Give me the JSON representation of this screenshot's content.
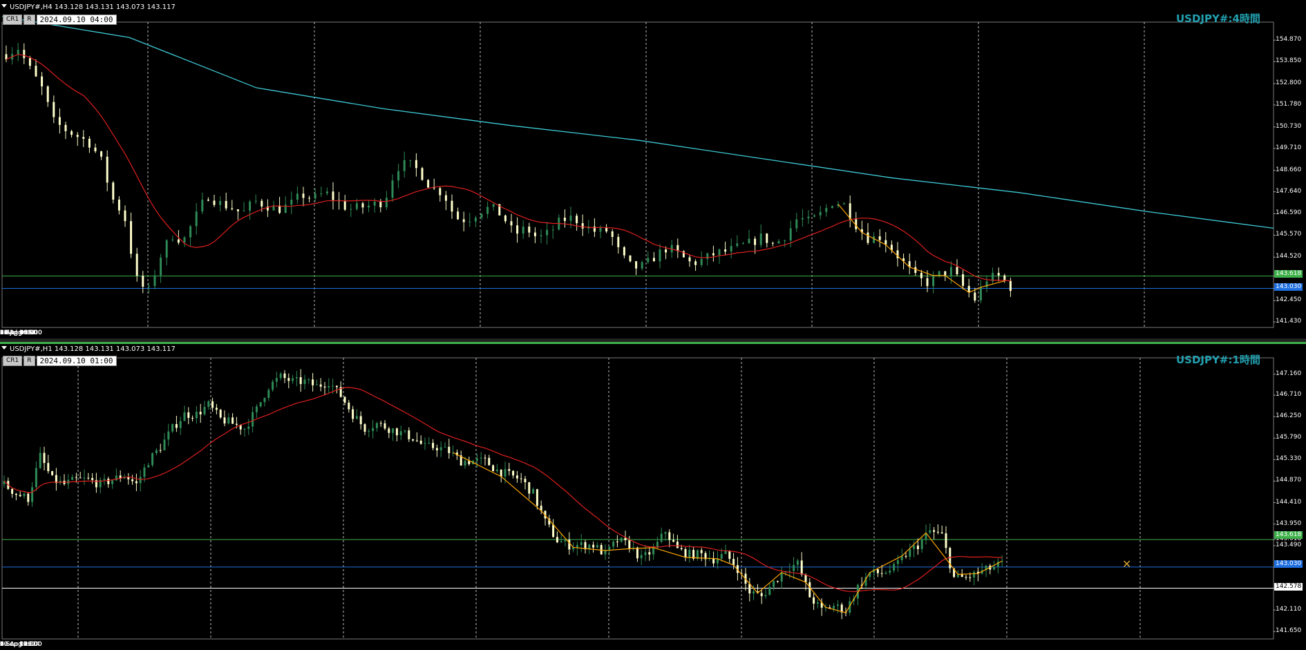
{
  "colors": {
    "bull": "#2e8b57",
    "bear": "#ffffcc",
    "ma_fast": "#e0201e",
    "ma_slow": "#3ecad6",
    "zigzag": "#ffa500",
    "title": "#22a0b0",
    "hline_green": "#3fb24b",
    "hline_blue": "#1f6fe0",
    "hline_white": "#ffffff"
  },
  "top": {
    "header": "USDJPY#,H4  143.128 143.131 143.073 143.117",
    "btn1": "CR1",
    "btn2": "R",
    "datetime": "2024.09.10 04:00",
    "window_title": "USDJPY#:4時間",
    "y_ticks": [
      "154.870",
      "153.850",
      "152.800",
      "151.780",
      "150.730",
      "149.710",
      "148.660",
      "147.640",
      "146.590",
      "145.570",
      "144.520",
      "143.618",
      "143.030",
      "142.450",
      "141.430"
    ],
    "x_ticks": [
      "29 Jul 2024",
      "31 Jul 00:00",
      "1 Aug 08:00",
      "2 Aug 16:00",
      "6 Aug 00:00",
      "7 Aug 08:00",
      "8 Aug 16:00",
      "12 Aug 00:00",
      "13 Aug 08:00",
      "14 Aug 16:00",
      "16 Aug 00:00",
      "19 Aug 08:00",
      "20 Aug 16:00",
      "22 Aug 00:00",
      "23 Aug 08:00",
      "26 Aug 16:00",
      "28 Aug 00:00",
      "29 Aug 08:00",
      "30 Aug 16:00",
      "3 Sep 00:00",
      "4 Sep 08:00",
      "5 Sep 16:00",
      "9 Sep 00:00"
    ],
    "price_tags": {
      "green": "143.618",
      "blue": "143.030"
    }
  },
  "bottom": {
    "header": "USDJPY#,H1  143.128 143.131 143.073 143.117",
    "btn1": "CR1",
    "btn2": "R",
    "datetime": "2024.09.10 01:00",
    "window_title": "USDJPY#:1時間",
    "y_ticks": [
      "147.160",
      "146.710",
      "146.250",
      "145.790",
      "145.330",
      "144.870",
      "144.410",
      "143.950",
      "143.618",
      "143.490",
      "143.030",
      "142.578",
      "142.110",
      "141.650"
    ],
    "x_ticks": [
      "29 Aug 2024",
      "29 Aug 18:00",
      "30 Aug 02:00",
      "30 Aug 10:00",
      "30 Aug 18:00",
      "2 Sep 02:00",
      "2 Sep 10:00",
      "2 Sep 18:00",
      "3 Sep 02:00",
      "3 Sep 10:00",
      "3 Sep 18:00",
      "4 Sep 02:00",
      "4 Sep 10:00",
      "4 Sep 18:00",
      "5 Sep 02:00",
      "5 Sep 10:00",
      "5 Sep 18:00",
      "6 Sep 02:00",
      "6 Sep 10:00",
      "6 Sep 18:00",
      "9 Sep 02:00",
      "9 Sep 10:00",
      "9 Sep 18:00"
    ],
    "price_tags": {
      "green": "143.618",
      "blue": "143.030",
      "white": "142.578"
    }
  },
  "chart_data": [
    {
      "type": "candlestick",
      "timeframe": "H4",
      "ylim": [
        141.3,
        155.6
      ],
      "close_path": [
        154.2,
        154.5,
        153.5,
        152.6,
        151.0,
        150.6,
        150.3,
        150.0,
        149.2,
        147.3,
        146.5,
        143.5,
        142.8,
        144.5,
        145.6,
        145.3,
        146.4,
        147.5,
        147.1,
        146.9,
        146.6,
        147.2,
        147.0,
        146.8,
        147.0,
        147.5,
        147.3,
        147.6,
        147.2,
        146.8,
        146.9,
        147.0,
        147.2,
        148.8,
        149.0,
        148.6,
        147.8,
        147.6,
        146.4,
        146.3,
        146.7,
        146.9,
        146.5,
        145.6,
        145.9,
        145.4,
        145.7,
        146.3,
        146.4,
        146.0,
        145.7,
        145.8,
        144.6,
        144.0,
        144.1,
        144.6,
        145.0,
        144.6,
        144.2,
        144.4,
        144.7,
        144.8,
        145.0,
        145.2,
        145.5,
        145.1,
        145.6,
        146.4,
        146.2,
        146.6,
        147.2,
        147.0,
        146.0,
        145.4,
        145.5,
        144.9,
        144.2,
        143.5,
        143.3,
        143.7,
        143.9,
        143.1,
        142.5,
        143.5,
        143.6,
        143.1
      ]
    },
    {
      "type": "candlestick",
      "timeframe": "H1",
      "ylim": [
        141.55,
        147.45
      ],
      "close_path": [
        144.8,
        144.6,
        144.5,
        145.4,
        144.9,
        144.8,
        144.9,
        144.9,
        144.8,
        144.9,
        145.0,
        144.8,
        145.3,
        145.6,
        146.0,
        146.3,
        146.3,
        146.5,
        146.2,
        146.1,
        146.0,
        146.4,
        146.9,
        147.1,
        147.0,
        147.0,
        146.9,
        147.0,
        146.7,
        146.3,
        146.0,
        146.1,
        146.0,
        145.9,
        145.8,
        145.6,
        145.6,
        145.5,
        145.3,
        145.3,
        145.3,
        145.1,
        145.0,
        144.9,
        144.6,
        144.0,
        143.6,
        143.5,
        143.5,
        143.5,
        143.3,
        143.6,
        143.5,
        143.2,
        143.4,
        143.8,
        143.4,
        143.3,
        143.3,
        143.2,
        143.3,
        143.0,
        142.5,
        142.4,
        142.7,
        143.0,
        143.1,
        142.4,
        142.1,
        142.2,
        142.1,
        142.6,
        142.9,
        142.9,
        143.0,
        143.3,
        143.5,
        143.8,
        143.7,
        142.8,
        142.8,
        142.9,
        143.0,
        143.1
      ]
    }
  ]
}
